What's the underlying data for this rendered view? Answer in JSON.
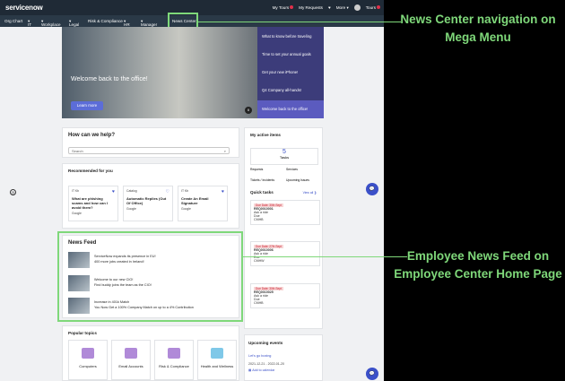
{
  "app": {
    "logo": "servicenow"
  },
  "topbar": {
    "links": [
      "My Tours",
      "My Requests",
      "More",
      "Tours"
    ]
  },
  "nav": {
    "items": [
      "Org Chart",
      "IT",
      "Workplace",
      "Legal",
      "Risk & Compliance",
      "HR",
      "Manager Hub",
      "News Center"
    ]
  },
  "hero": {
    "title": "Welcome back to the office!",
    "button": "Learn more",
    "pause": "II"
  },
  "mega": {
    "items": [
      "What to know before traveling",
      "Time to set your annual goals",
      "Get your new iPhone!",
      "Q4 Company all-hands!",
      "Welcome back to the office!"
    ]
  },
  "help": {
    "title": "How can we help?",
    "placeholder": "Search",
    "search_icon": "⌕"
  },
  "recommended": {
    "title": "Recommended for you",
    "items": [
      {
        "source": "IT Kb",
        "title": "What are phishing scams and how can I avoid them?",
        "meta": "Google"
      },
      {
        "source": "Catalog",
        "title": "Automatic Replies (Out Of Office)",
        "meta": "Google"
      },
      {
        "source": "IT Kb",
        "title": "Create An Email Signature",
        "meta": "Google"
      }
    ]
  },
  "news": {
    "title": "News Feed",
    "items": [
      {
        "title": "ServiceNow expands its presence in EU!",
        "sub": "400 more jobs created in Ireland!"
      },
      {
        "title": "Welcome to our new CIO!",
        "sub": "Find buddy joins the team as the CIO!"
      },
      {
        "title": "Increase in 401k Match",
        "sub": "You Now Get a 100% Company Match on up to a 4% Contribution"
      }
    ]
  },
  "topics": {
    "title": "Popular topics",
    "items": [
      "Computers",
      "Email Accounts",
      "Risk & Compliance",
      "Health and Wellness"
    ]
  },
  "active": {
    "title": "My active items",
    "count": "5",
    "count_label": "Tasks",
    "links": [
      "Requests",
      "Services",
      "Tickets / Incidents",
      "Upcoming Issues"
    ]
  },
  "quick": {
    "title": "Quick tasks",
    "view_all": "View all ❯",
    "tasks": [
      {
        "tag": "Due Date: 30th Sept",
        "id": "REQ0010001",
        "l1": "Ask a ride",
        "l2": "Due",
        "l3": "CMHB"
      },
      {
        "tag": "Due Date: 27th Sept",
        "id": "REQ0010006",
        "l1": "Ask a ride",
        "l2": "Due",
        "l3": "CMHW"
      },
      {
        "tag": "Due Date: 30th Sept",
        "id": "REQ0010025",
        "l1": "Ask a ride",
        "l2": "Due",
        "l3": "CMHB"
      }
    ]
  },
  "events": {
    "title": "Upcoming events",
    "name": "Let's go boxing",
    "date": "2021-12-21 - 2022-01-20",
    "add": "Add to calendar"
  },
  "annotations": {
    "nav_line1": "News Center navigation on",
    "nav_line2": "Mega Menu",
    "feed_line1": "Employee News Feed on",
    "feed_line2": "Employee Center Home Page"
  },
  "colors": {
    "highlight": "#7fd87a",
    "brand": "#1f2a36",
    "accent": "#3b50c8"
  }
}
